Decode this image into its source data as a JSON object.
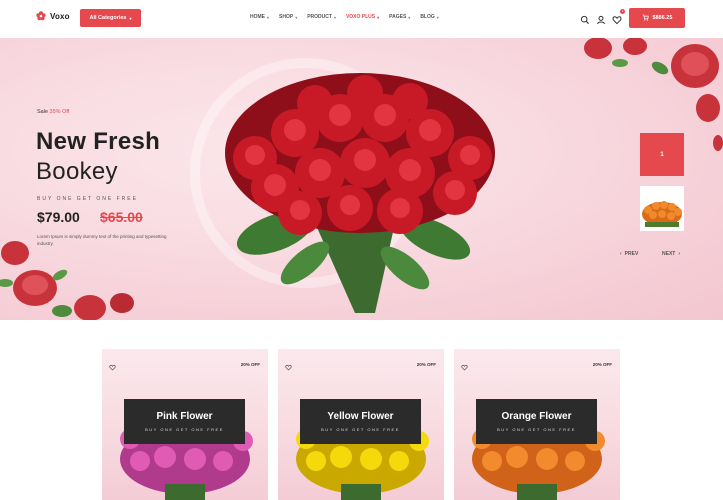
{
  "header": {
    "brand": "Voxo",
    "categories_button": "All Categories",
    "nav": [
      {
        "label": "HOME",
        "active": false
      },
      {
        "label": "SHOP",
        "active": false
      },
      {
        "label": "PRODUCT",
        "active": false
      },
      {
        "label": "VOXO PLUS",
        "active": true
      },
      {
        "label": "PAGES",
        "active": false
      },
      {
        "label": "BLOG",
        "active": false
      }
    ],
    "icons": [
      "search-icon",
      "user-icon",
      "wishlist-icon"
    ],
    "wishlist_count": "1",
    "cart_label": "$886.25"
  },
  "hero": {
    "sale_label": "Sale",
    "sale_pct": "35% Off",
    "title": "New Fresh",
    "subtitle": "Bookey",
    "promo": "BUY ONE GET ONE FREE",
    "price": "$79.00",
    "old_price": "$65.00",
    "description": "Lorem Ipsum is simply dummy text of the printing and typesetting industry.",
    "side_card": "1",
    "prev_label": "PREV",
    "next_label": "NEXT"
  },
  "cards": [
    {
      "title": "Pink Flower",
      "subtitle": "BUY ONE GET ONE FREE",
      "off": "20% OFF"
    },
    {
      "title": "Yellow Flower",
      "subtitle": "BUY ONE GET ONE FREE",
      "off": "20% OFF"
    },
    {
      "title": "Orange Flower",
      "subtitle": "BUY ONE GET ONE FREE",
      "off": "20% OFF"
    }
  ],
  "colors": {
    "accent": "#e5484d",
    "dark_label": "#2b2b2b",
    "hero_bg": "#f9dde3"
  }
}
